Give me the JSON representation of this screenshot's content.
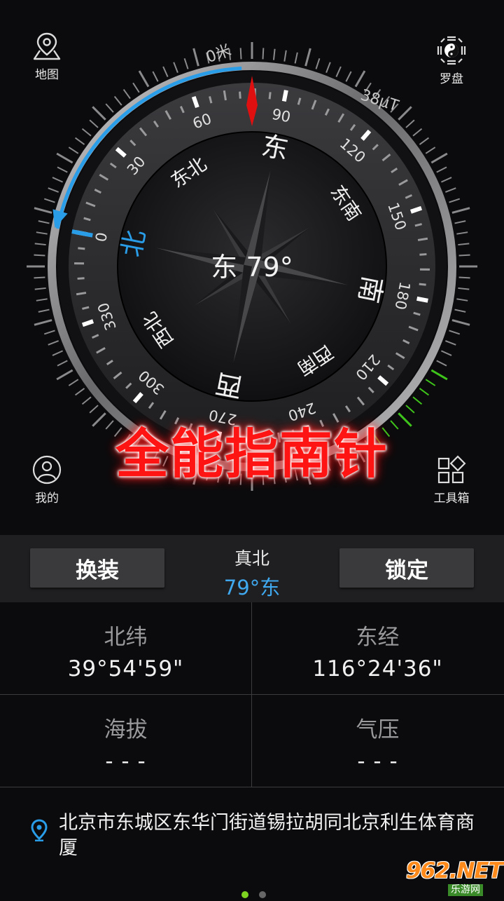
{
  "top_buttons": {
    "map": "地图",
    "luopan": "罗盘",
    "me": "我的",
    "toolbox": "工具箱"
  },
  "compass": {
    "heading_degrees": 79,
    "heading_text": "东 79°",
    "altitude_label": "0米",
    "magnetic_label": "38μT",
    "degree_ticks": [
      "0",
      "30",
      "60",
      "90",
      "120",
      "150",
      "180",
      "210",
      "240",
      "270",
      "300",
      "330"
    ],
    "directions": {
      "N": "北",
      "NE": "东北",
      "E": "东",
      "SE": "东南",
      "S": "南",
      "SW": "西南",
      "W": "西",
      "NW": "西北"
    },
    "accent_blue": "#2a9de8",
    "accent_red": "#e01010",
    "accent_green": "#3ec41a"
  },
  "banner": "全能指南针",
  "controls": {
    "skin_button": "换装",
    "lock_button": "锁定",
    "heading_label": "真北",
    "heading_value": "79°东"
  },
  "info": {
    "latitude_label": "北纬",
    "latitude_value": "39°54'59\"",
    "longitude_label": "东经",
    "longitude_value": "116°24'36\"",
    "altitude_label": "海拔",
    "altitude_value": "- - -",
    "pressure_label": "气压",
    "pressure_value": "- - -"
  },
  "address": "北京市东城区东华门街道锡拉胡同北京利生体育商厦",
  "page_indicator": {
    "active_color": "#7ed321",
    "inactive_color": "#666666"
  },
  "watermark": {
    "top": "962.NET",
    "bottom": "乐游网"
  }
}
